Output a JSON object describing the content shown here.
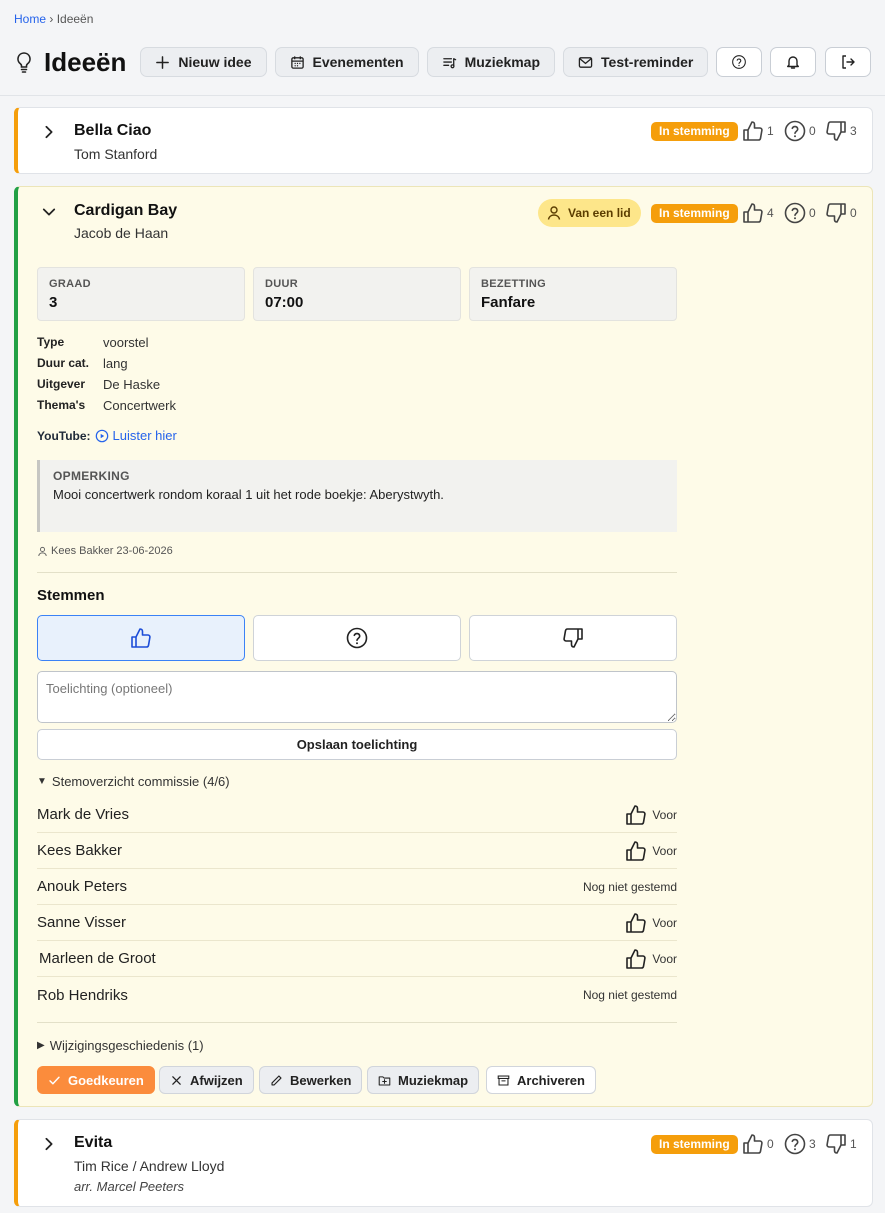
{
  "breadcrumb": {
    "home": "Home",
    "sep": "›",
    "current": "Ideeën"
  },
  "header": {
    "title": "Ideeën",
    "buttons": {
      "new": "Nieuw idee",
      "events": "Evenementen",
      "music": "Muziekmap",
      "reminder": "Test-reminder"
    }
  },
  "ideas": [
    {
      "title": "Bella Ciao",
      "subtitle": "Tom Stanford",
      "status": "In stemming",
      "votes": {
        "up": "1",
        "maybe": "0",
        "down": "3"
      }
    },
    {
      "title": "Cardigan Bay",
      "subtitle": "Jacob de Haan",
      "member_badge": "Van een lid",
      "status": "In stemming",
      "votes": {
        "up": "4",
        "maybe": "0",
        "down": "0"
      },
      "stats": [
        {
          "label": "GRAAD",
          "value": "3"
        },
        {
          "label": "DUUR",
          "value": "07:00"
        },
        {
          "label": "BEZETTING",
          "value": "Fanfare"
        }
      ],
      "details": [
        {
          "key": "Type",
          "value": "voorstel"
        },
        {
          "key": "Duur cat.",
          "value": "lang"
        },
        {
          "key": "Uitgever",
          "value": "De Haske"
        },
        {
          "key": "Thema's",
          "value": "Concertwerk"
        }
      ],
      "youtube_label": "YouTube:",
      "youtube_link": "Luister hier",
      "remark_label": "OPMERKING",
      "remark_text": "Mooi concertwerk rondom koraal 1 uit het rode boekje: Aberystwyth.",
      "author": "Kees Bakker 23-06-2026",
      "voting_title": "Stemmen",
      "comment_placeholder": "Toelichting (optioneel)",
      "save_label": "Opslaan toelichting",
      "overview_label": "Stemoverzicht commissie (4/6)",
      "committee": [
        {
          "name": "Mark de Vries",
          "status": "Voor"
        },
        {
          "name": "Kees Bakker",
          "status": "Voor"
        },
        {
          "name": "Anouk Peters",
          "status": "Nog niet gestemd"
        },
        {
          "name": "Sanne Visser",
          "status": "Voor"
        },
        {
          "name": "Marleen de Groot",
          "status": "Voor"
        },
        {
          "name": "Rob Hendriks",
          "status": "Nog niet gestemd"
        }
      ],
      "history_label": "Wijzigingsgeschiedenis (1)",
      "actions": {
        "approve": "Goedkeuren",
        "reject": "Afwijzen",
        "edit": "Bewerken",
        "music": "Muziekmap",
        "archive": "Archiveren"
      }
    },
    {
      "title": "Evita",
      "subtitle": "Tim Rice / Andrew Lloyd",
      "arranger": "arr. Marcel Peeters",
      "status": "In stemming",
      "votes": {
        "up": "0",
        "maybe": "3",
        "down": "1"
      }
    }
  ],
  "colors": {
    "accent": "#f59e0b",
    "approved": "#22a045",
    "primary_button": "#fb8c3c",
    "link": "#2563eb"
  }
}
